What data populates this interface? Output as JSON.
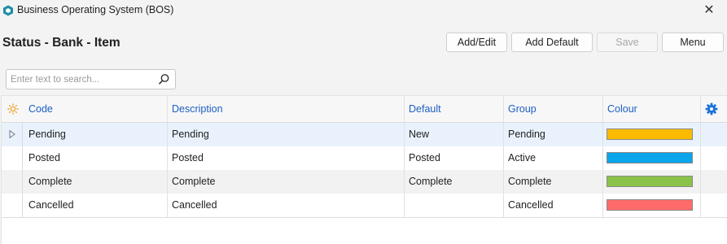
{
  "window": {
    "title": "Business Operating System (BOS)",
    "close_label": "✕"
  },
  "page": {
    "title": "Status - Bank - Item"
  },
  "toolbar": {
    "add_edit_label": "Add/Edit",
    "add_default_label": "Add Default",
    "save_label": "Save",
    "menu_label": "Menu"
  },
  "search": {
    "placeholder": "Enter text to search..."
  },
  "grid": {
    "columns": [
      "Code",
      "Description",
      "Default",
      "Group",
      "Colour"
    ],
    "rows": [
      {
        "code": "Pending",
        "description": "Pending",
        "default": "New",
        "group": "Pending",
        "colour": "#fbbb00"
      },
      {
        "code": "Posted",
        "description": "Posted",
        "default": "Posted",
        "group": "Active",
        "colour": "#0aa5ea"
      },
      {
        "code": "Complete",
        "description": "Complete",
        "default": "Complete",
        "group": "Complete",
        "colour": "#8bc34a"
      },
      {
        "code": "Cancelled",
        "description": "Cancelled",
        "default": "",
        "group": "Cancelled",
        "colour": "#ff6b6b"
      }
    ]
  },
  "colors": {
    "accent": "#1c5fc4",
    "selected_row": "#e9f2fc",
    "alt_row": "#f2f2f2",
    "settings_icon": "#1a73d9",
    "sun_icon": "#f0a020",
    "app_icon": "#1d8fa3"
  }
}
